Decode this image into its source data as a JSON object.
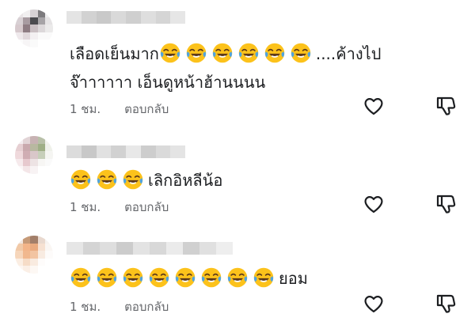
{
  "comments": [
    {
      "emoji_count": 6,
      "text_before": "เลือดเย็นมาก",
      "text_after": "....ค้างไป",
      "line2": "จ๊าาาาาา เอ็นดูหน้าฮ้านนนน",
      "time": "1 ชม.",
      "reply_label": "ตอบกลับ"
    },
    {
      "emoji_count": 3,
      "text_before": "",
      "text_after": "เลิกอิหลีน้อ",
      "line2": "",
      "time": "1 ชม.",
      "reply_label": "ตอบกลับ"
    },
    {
      "emoji_count": 8,
      "text_before": "",
      "text_after": "ยอม",
      "line2": "",
      "time": "1 ชม.",
      "reply_label": "ตอบกลับ"
    }
  ],
  "icons": {
    "like": "heart-outline-icon",
    "dislike": "thumbs-down-icon",
    "emoji": "face-with-tears-of-joy"
  },
  "colors": {
    "text": "#1c1e21",
    "meta": "#65676b",
    "emoji_face": "#fcc21b",
    "emoji_tears": "#4fa3e0"
  }
}
